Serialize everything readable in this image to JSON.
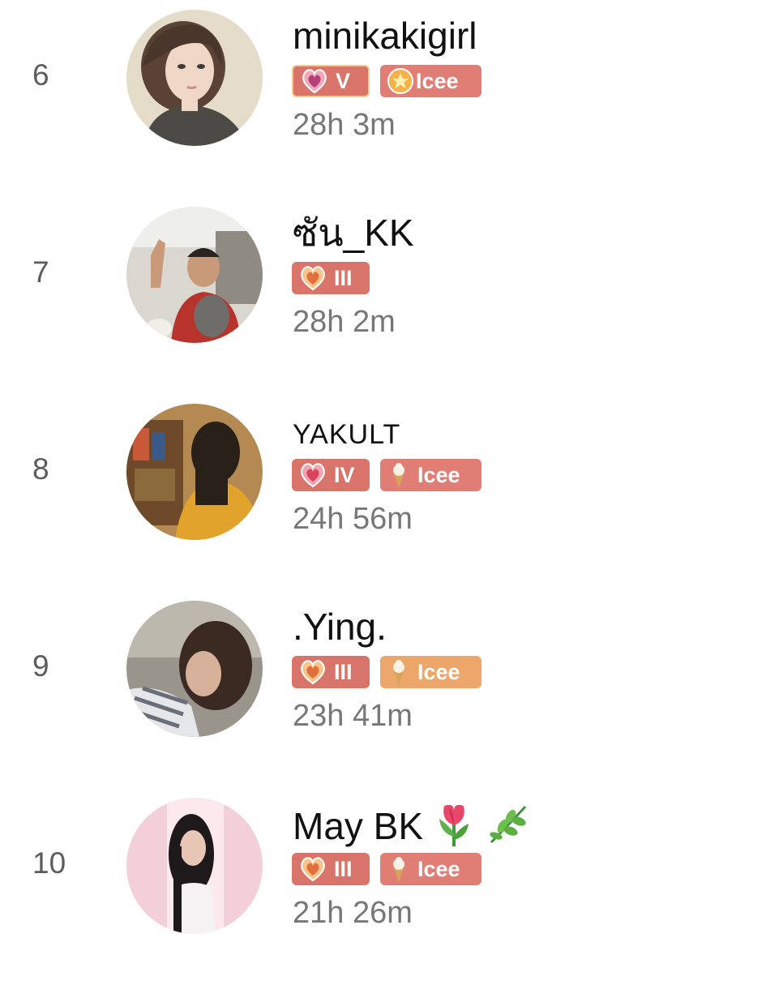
{
  "leaderboard": {
    "entries": [
      {
        "rank": "6",
        "name": "minikakigirl",
        "level": "V",
        "club_label": "Icee",
        "time": "28h 3m"
      },
      {
        "rank": "7",
        "name": "ซัน_KK",
        "level": "III",
        "time": "28h 2m"
      },
      {
        "rank": "8",
        "name": "YAKULT",
        "level": "IV",
        "club_label": "Icee",
        "time": "24h 56m"
      },
      {
        "rank": "9",
        "name": ".Ying.",
        "level": "III",
        "club_label": "Icee",
        "time": "23h 41m"
      },
      {
        "rank": "10",
        "name": "May BK",
        "level": "III",
        "club_label": "Icee",
        "time": "21h 26m"
      }
    ]
  },
  "icons": {
    "level_badge": "heart-level-icon",
    "club_badge_1": "star-icon",
    "club_badge_other": "ice-cream-icon",
    "name_emojis": [
      "tulip-icon",
      "herb-icon"
    ]
  },
  "colors": {
    "badge_level": "#d9746a",
    "badge_club": "#e07e76",
    "badge_club_orange": "#eca66a",
    "rank_text": "#5c5c5c",
    "time_text": "#777777"
  }
}
